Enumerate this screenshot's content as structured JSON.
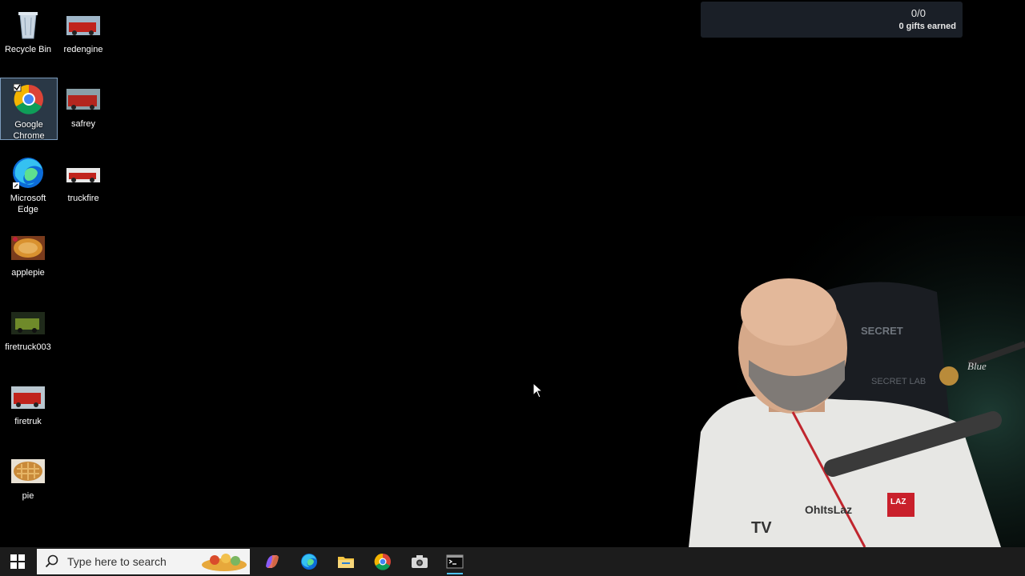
{
  "desktop": {
    "icons": [
      {
        "label": "Recycle Bin"
      },
      {
        "label": "redengine"
      },
      {
        "label": "Google Chrome"
      },
      {
        "label": "safrey"
      },
      {
        "label": "Microsoft Edge"
      },
      {
        "label": "truckfire"
      },
      {
        "label": "applepie"
      },
      {
        "label": "firetruck003"
      },
      {
        "label": "firetruk"
      },
      {
        "label": "pie"
      }
    ]
  },
  "overlay": {
    "gifts_count": "0/0",
    "gifts_label": "0 gifts earned"
  },
  "webcam": {
    "chair_brand": "SECRET",
    "chair_brand_2": "SECRET LAB",
    "mic_brand": "Blue",
    "shirt_text": "OhItsLaz",
    "shirt_badge": "LAZ",
    "shirt_logo": "TV"
  },
  "taskbar": {
    "search_placeholder": "Type here to search",
    "apps": [
      "copilot",
      "edge",
      "file-explorer",
      "chrome",
      "camera",
      "terminal"
    ]
  }
}
